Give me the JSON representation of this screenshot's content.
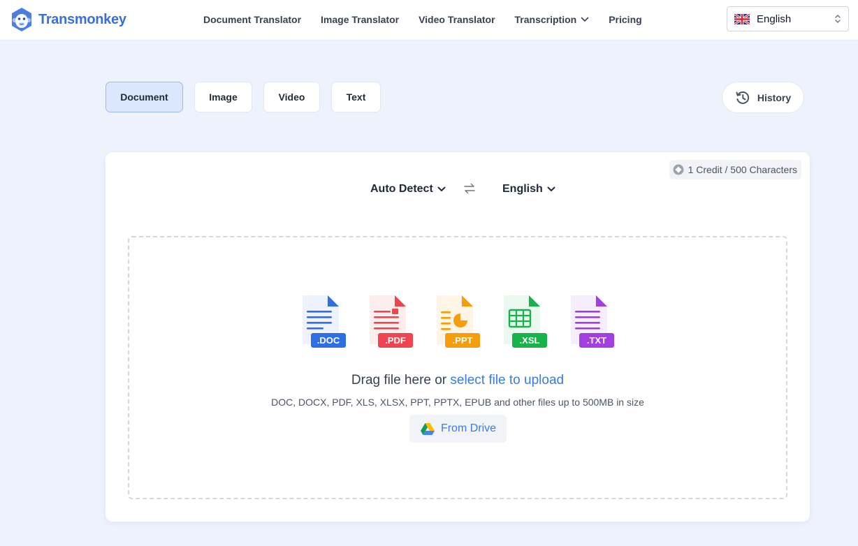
{
  "header": {
    "brand": "Transmonkey",
    "nav": [
      {
        "label": "Document Translator"
      },
      {
        "label": "Image Translator"
      },
      {
        "label": "Video Translator"
      },
      {
        "label": "Transcription"
      },
      {
        "label": "Pricing"
      }
    ],
    "language": "English"
  },
  "tabs": [
    {
      "label": "Document"
    },
    {
      "label": "Image"
    },
    {
      "label": "Video"
    },
    {
      "label": "Text"
    }
  ],
  "history_label": "History",
  "card": {
    "credit": "1 Credit / 500 Characters",
    "source_language": "Auto Detect",
    "target_language": "English",
    "file_types": [
      ".DOC",
      ".PDF",
      ".PPT",
      ".XSL",
      ".TXT"
    ],
    "upload_prefix": "Drag file here or",
    "upload_link": "select file to upload",
    "formats_note": "DOC, DOCX, PDF, XLS, XLSX, PPT, PPTX, EPUB and other files up to 500MB in size",
    "drive_label": "From Drive"
  },
  "colors": {
    "brand": "#3b6fd8",
    "link": "#3b7be0",
    "doc": "#2f6fe4",
    "pdf": "#ef4452",
    "ppt": "#f59e0b",
    "xsl": "#17b34a",
    "txt": "#a33fe0"
  }
}
